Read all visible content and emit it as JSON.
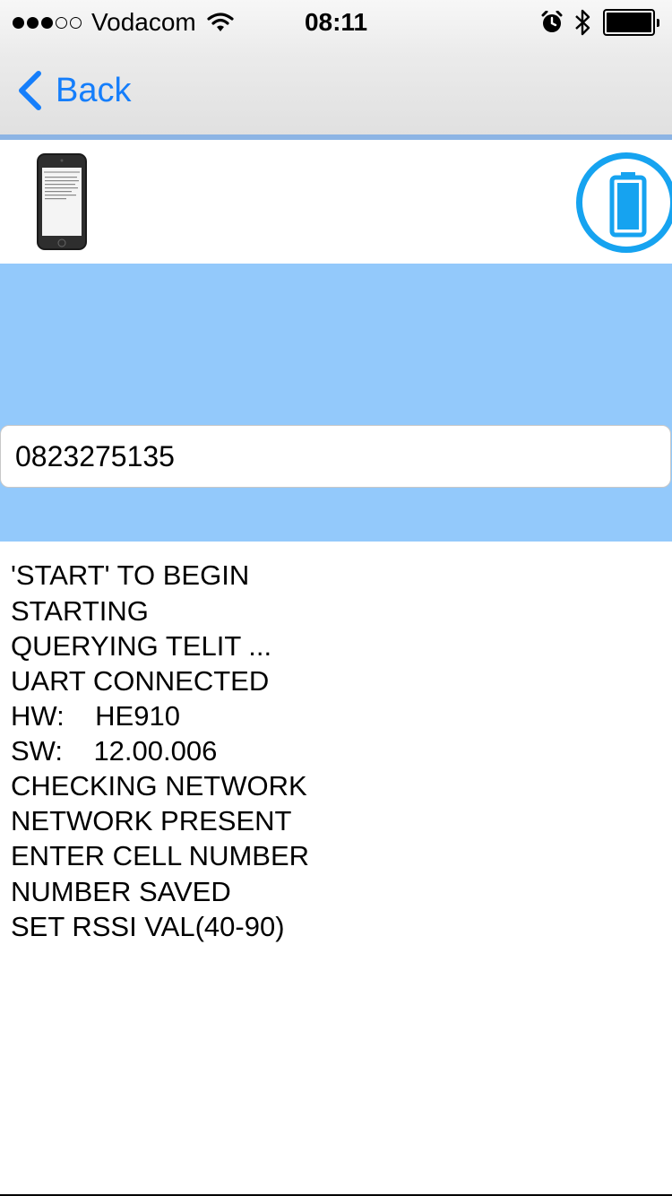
{
  "status_bar": {
    "signal_bars_filled": 3,
    "signal_bars_total": 5,
    "carrier": "Vodacom",
    "time": "08:11",
    "icons": [
      "wifi-icon",
      "alarm-icon",
      "bluetooth-icon",
      "battery-icon"
    ],
    "battery_level": 1.0
  },
  "nav": {
    "back_label": "Back",
    "accent_color": "#157efb"
  },
  "device": {
    "phone_icon": "phone-thumbnail",
    "battery_icon": "battery-full-icon",
    "battery_color": "#16a3f0"
  },
  "input": {
    "value": "0823275135"
  },
  "panel_color": "#93c9fb",
  "log": {
    "lines": [
      "'START' TO BEGIN",
      "STARTING",
      "QUERYING TELIT ...",
      "UART CONNECTED",
      "HW:    HE910",
      "SW:    12.00.006",
      "CHECKING NETWORK",
      "NETWORK PRESENT",
      "ENTER CELL NUMBER",
      "NUMBER SAVED",
      "SET RSSI VAL(40-90)"
    ]
  }
}
